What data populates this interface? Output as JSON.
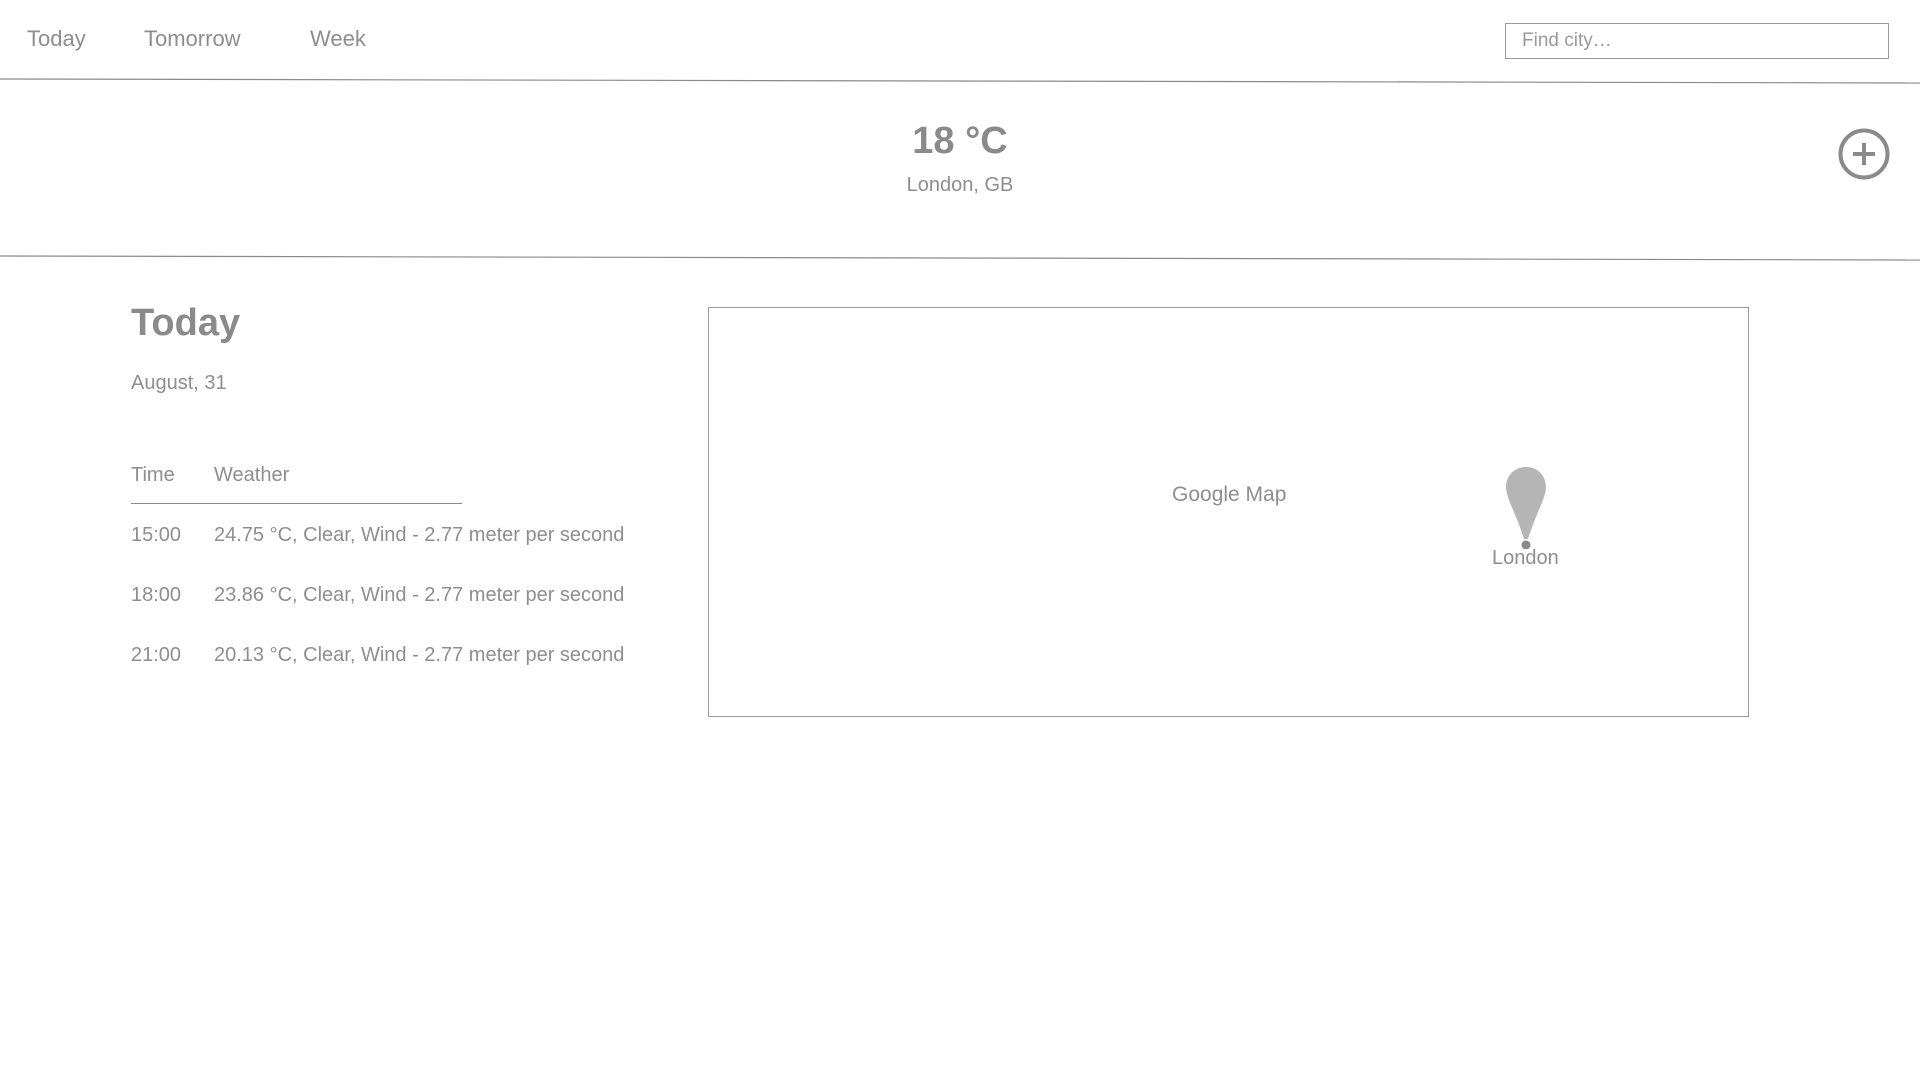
{
  "nav": {
    "tabs": [
      {
        "label": "Today"
      },
      {
        "label": "Tomorrow"
      },
      {
        "label": "Week"
      }
    ],
    "search": {
      "placeholder": "Find city…",
      "value": ""
    }
  },
  "current": {
    "temperature": "18 °C",
    "location": "London, GB",
    "add_icon": "plus-circle-icon"
  },
  "day": {
    "title": "Today",
    "date": "August, 31"
  },
  "forecast": {
    "headers": {
      "time": "Time",
      "weather": "Weather"
    },
    "rows": [
      {
        "time": "15:00",
        "weather": "24.75 °C, Clear, Wind - 2.77 meter per second"
      },
      {
        "time": "18:00",
        "weather": "23.86 °C, Clear, Wind - 2.77 meter per second"
      },
      {
        "time": "21:00",
        "weather": "20.13 °C, Clear, Wind - 2.77 meter per second"
      }
    ]
  },
  "map": {
    "label": "Google Map",
    "marker_label": "London",
    "marker_icon": "map-pin-icon"
  },
  "colors": {
    "text": "#8e8e8e",
    "border": "#9a9a9a",
    "pin": "#b5b5b5"
  }
}
